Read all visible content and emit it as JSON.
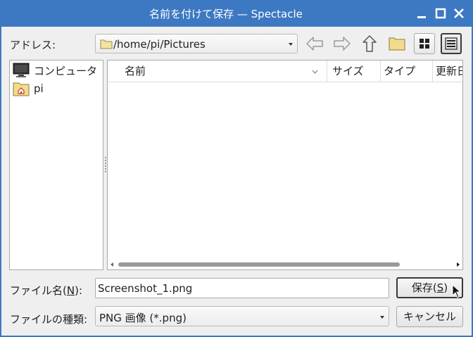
{
  "window": {
    "title": "名前を付けて保存 — Spectacle"
  },
  "address": {
    "label": "アドレス:",
    "path": "/home/pi/Pictures"
  },
  "places": [
    {
      "label": "コンピュータ",
      "icon": "computer-icon"
    },
    {
      "label": "pi",
      "icon": "home-folder-icon"
    }
  ],
  "filelist": {
    "columns": [
      "名前",
      "サイズ",
      "タイプ",
      "更新日"
    ]
  },
  "filename": {
    "label_prefix": "ファイル名(",
    "mnemonic": "N",
    "label_suffix": "):",
    "value": "Screenshot_1.png"
  },
  "save_button": {
    "label_prefix": "保存(",
    "mnemonic": "S",
    "label_suffix": ")"
  },
  "filetype": {
    "label": "ファイルの種類:",
    "selected": "PNG 画像 (*.png)"
  },
  "cancel_button": {
    "label": "キャンセル"
  },
  "colors": {
    "titlebar": "#3d79c2",
    "background": "#efefef"
  }
}
